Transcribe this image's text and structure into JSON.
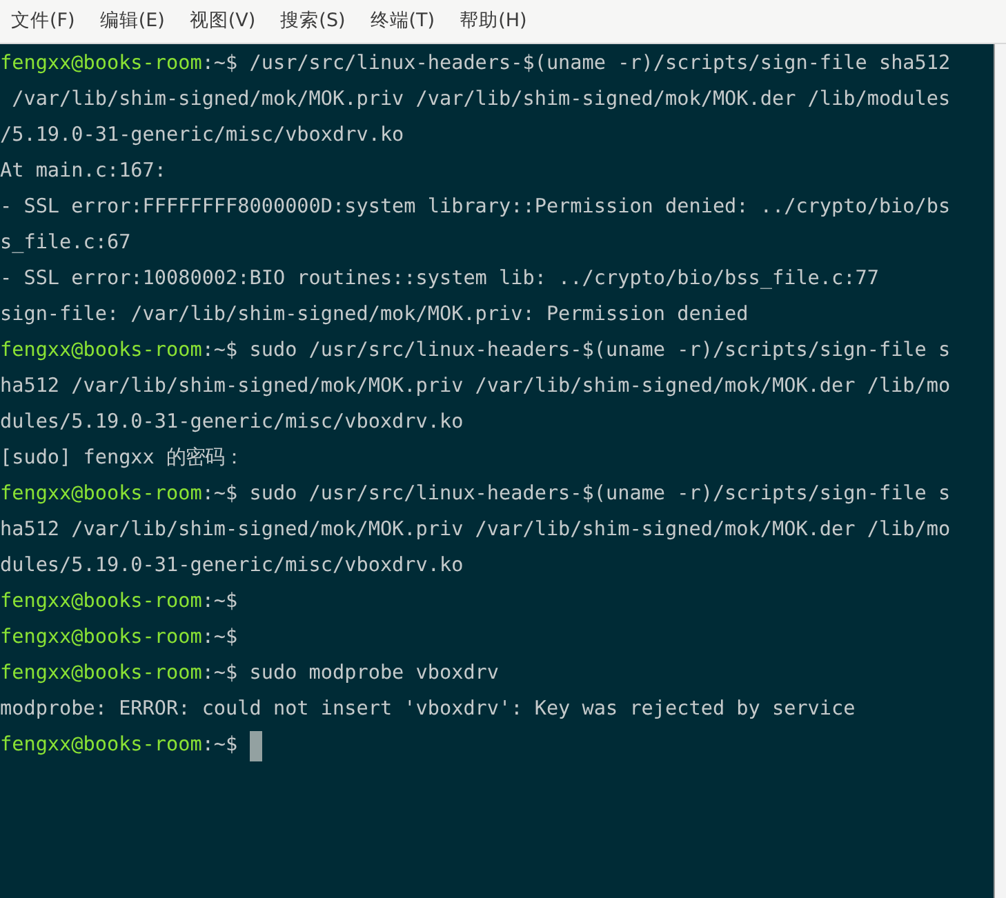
{
  "menu": [
    "文件(F)",
    "编辑(E)",
    "视图(V)",
    "搜索(S)",
    "终端(T)",
    "帮助(H)"
  ],
  "lines": [
    {
      "kind": "prompt",
      "user": "fengxx@books-room",
      "path": ":~$",
      "command": " /usr/src/linux-headers-$(uname -r)/scripts/sign-file sha512"
    },
    {
      "kind": "output",
      "text": " /var/lib/shim-signed/mok/MOK.priv /var/lib/shim-signed/mok/MOK.der /lib/modules"
    },
    {
      "kind": "output",
      "text": "/5.19.0-31-generic/misc/vboxdrv.ko"
    },
    {
      "kind": "output",
      "text": "At main.c:167:"
    },
    {
      "kind": "output",
      "text": "- SSL error:FFFFFFFF8000000D:system library::Permission denied: ../crypto/bio/bs"
    },
    {
      "kind": "output",
      "text": "s_file.c:67"
    },
    {
      "kind": "output",
      "text": "- SSL error:10080002:BIO routines::system lib: ../crypto/bio/bss_file.c:77"
    },
    {
      "kind": "output",
      "text": "sign-file: /var/lib/shim-signed/mok/MOK.priv: Permission denied"
    },
    {
      "kind": "prompt",
      "user": "fengxx@books-room",
      "path": ":~$",
      "command": " sudo /usr/src/linux-headers-$(uname -r)/scripts/sign-file s"
    },
    {
      "kind": "output",
      "text": "ha512 /var/lib/shim-signed/mok/MOK.priv /var/lib/shim-signed/mok/MOK.der /lib/mo"
    },
    {
      "kind": "output",
      "text": "dules/5.19.0-31-generic/misc/vboxdrv.ko"
    },
    {
      "kind": "output",
      "text": "[sudo] fengxx 的密码："
    },
    {
      "kind": "prompt",
      "user": "fengxx@books-room",
      "path": ":~$",
      "command": " sudo /usr/src/linux-headers-$(uname -r)/scripts/sign-file s"
    },
    {
      "kind": "output",
      "text": "ha512 /var/lib/shim-signed/mok/MOK.priv /var/lib/shim-signed/mok/MOK.der /lib/mo"
    },
    {
      "kind": "output",
      "text": "dules/5.19.0-31-generic/misc/vboxdrv.ko"
    },
    {
      "kind": "prompt",
      "user": "fengxx@books-room",
      "path": ":~$"
    },
    {
      "kind": "prompt",
      "user": "fengxx@books-room",
      "path": ":~$"
    },
    {
      "kind": "prompt",
      "user": "fengxx@books-room",
      "path": ":~$",
      "command": " sudo modprobe vboxdrv"
    },
    {
      "kind": "output",
      "text": "modprobe: ERROR: could not insert 'vboxdrv': Key was rejected by service"
    },
    {
      "kind": "prompt",
      "user": "fengxx@books-room",
      "path": ":~$",
      "cursor": true
    }
  ]
}
